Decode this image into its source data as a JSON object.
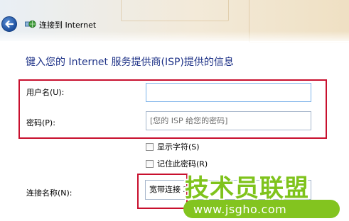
{
  "window": {
    "title": "连接到 Internet",
    "back_icon": "back-arrow-icon",
    "title_icon": "network-globe-icon"
  },
  "heading": "键入您的 Internet 服务提供商(ISP)提供的信息",
  "form": {
    "username": {
      "label": "用户名(U):",
      "value": "",
      "placeholder": ""
    },
    "password": {
      "label": "密码(P):",
      "value": "",
      "placeholder": "[您的 ISP 给您的密码]"
    },
    "show_chars": {
      "label": "显示字符(S)",
      "checked": false
    },
    "remember_password": {
      "label": "记住此密码(R)",
      "checked": false
    },
    "connection_name": {
      "label": "连接名称(N):",
      "value": "宽带连接 2"
    }
  },
  "watermark": {
    "brand": "技术员联盟",
    "url": "www.jsgho.com"
  },
  "colors": {
    "heading": "#1e3287",
    "highlight_frame": "#c8102e",
    "watermark_green": "#7fc31c"
  }
}
